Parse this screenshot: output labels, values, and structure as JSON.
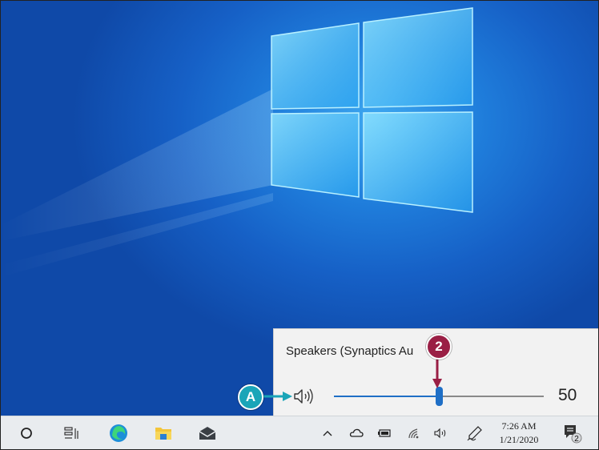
{
  "desktop": {
    "wallpaper": "windows-10-logo"
  },
  "volume_flyout": {
    "device_name": "Speakers (Synaptics Au",
    "volume_value": "50",
    "volume_level_percent": 50,
    "accent_color": "#1f6fc6"
  },
  "callouts": {
    "step": "2",
    "label": "A"
  },
  "taskbar": {
    "pinned": [
      "search-icon",
      "task-view-icon",
      "edge-icon",
      "file-explorer-icon",
      "mail-icon"
    ],
    "tray": [
      "chevron-up-icon",
      "onedrive-icon",
      "battery-icon",
      "wifi-icon",
      "speaker-icon",
      "pen-icon"
    ],
    "clock_time": "7:26 AM",
    "clock_date": "1/21/2020",
    "notification_count": "2"
  }
}
